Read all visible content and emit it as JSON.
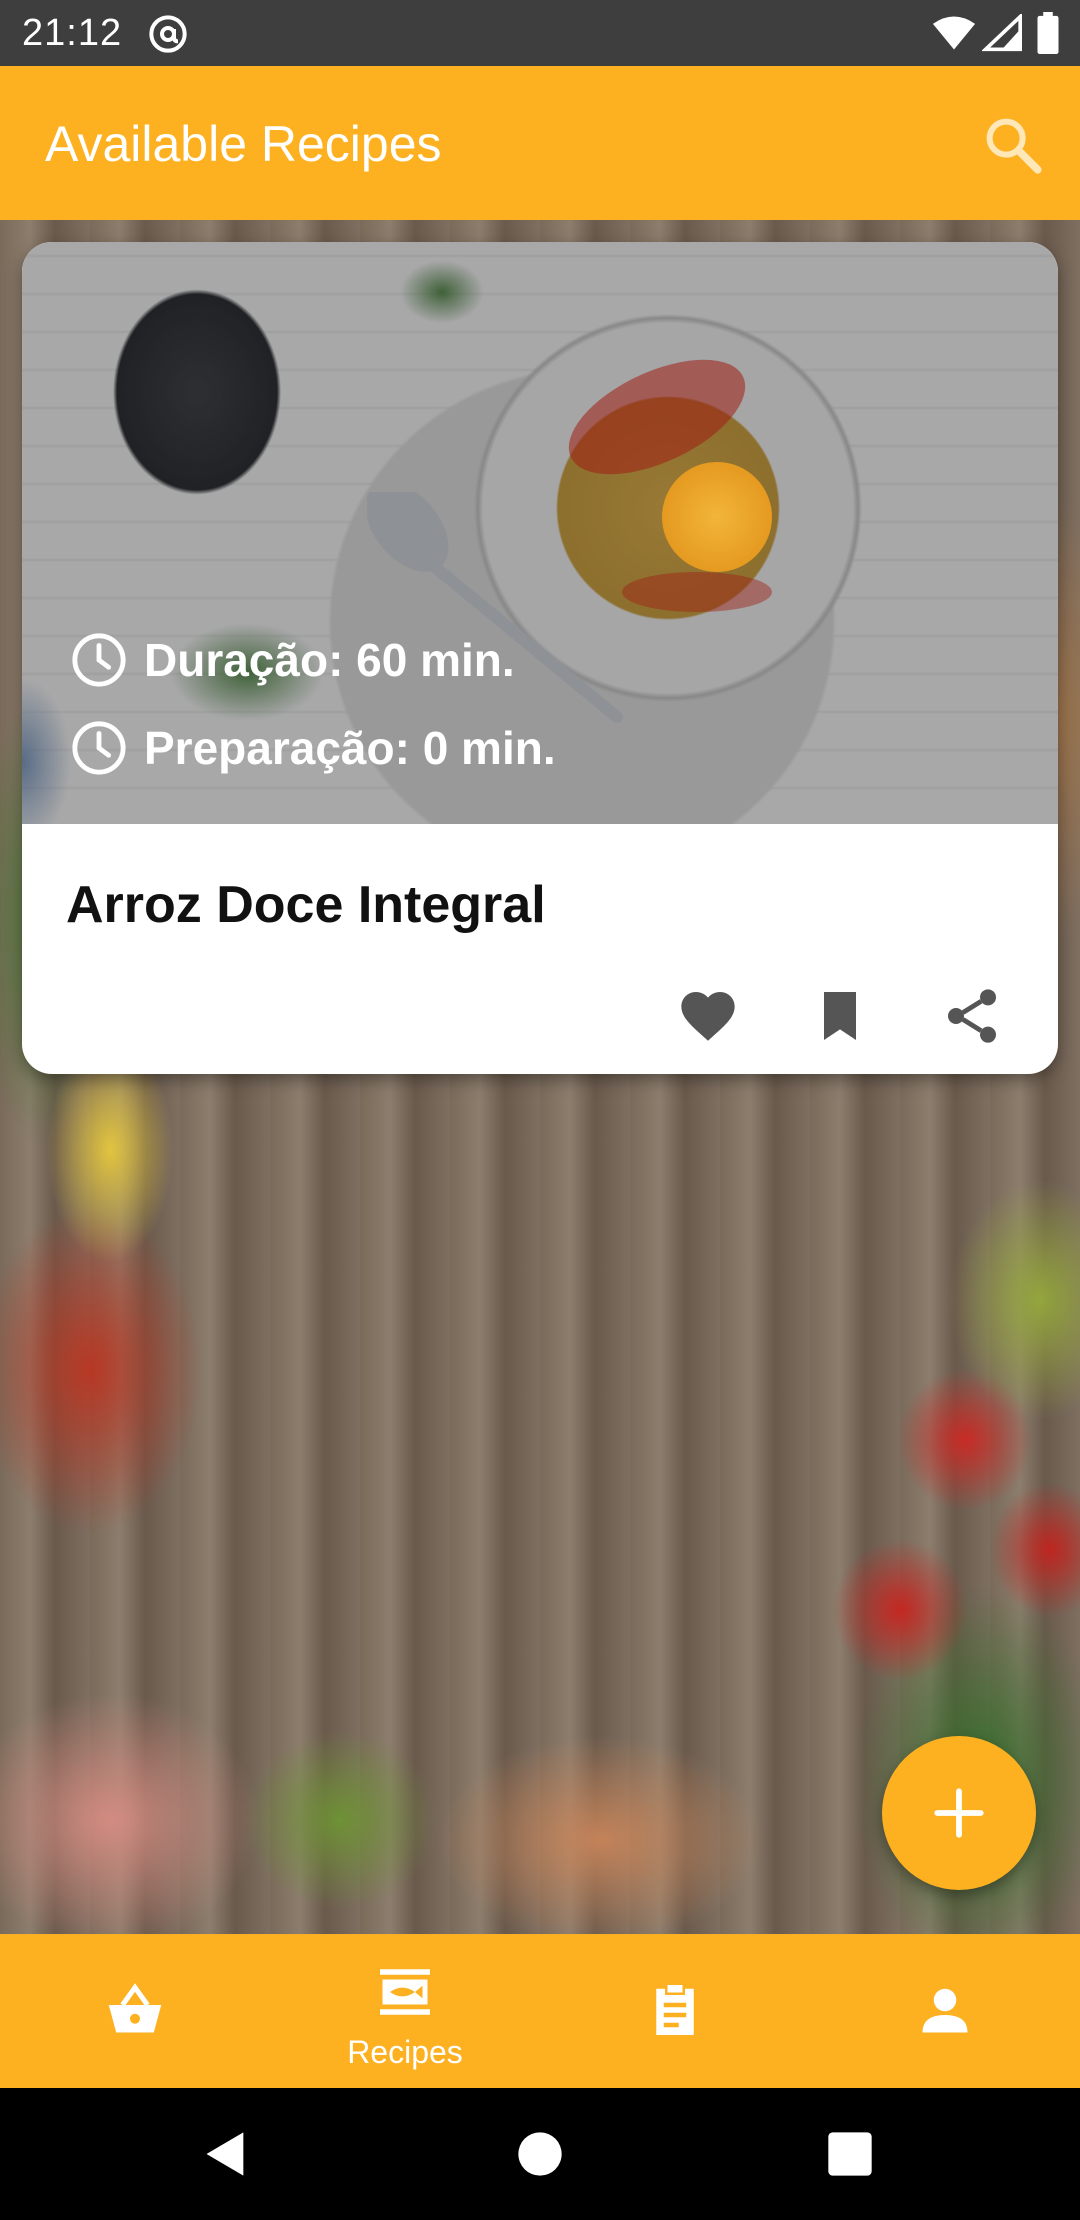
{
  "status_bar": {
    "time": "21:12",
    "icons": [
      "at-sign-icon",
      "wifi-icon",
      "cell-signal-icon",
      "battery-icon"
    ]
  },
  "app_bar": {
    "title": "Available Recipes",
    "search_icon": "search-icon"
  },
  "recipe_card": {
    "duration": "Duração: 60 min.",
    "preparation": "Preparação: 0 min.",
    "title": "Arroz Doce Integral",
    "actions": [
      "heart-icon",
      "bookmark-icon",
      "share-icon"
    ]
  },
  "fab": {
    "icon": "plus-icon"
  },
  "bottom_nav": {
    "items": [
      {
        "icon": "shopping-basket-icon",
        "label": ""
      },
      {
        "icon": "recipes-icon",
        "label": "Recipes"
      },
      {
        "icon": "clipboard-icon",
        "label": ""
      },
      {
        "icon": "person-icon",
        "label": ""
      }
    ],
    "active_index": 1
  },
  "system_nav": {
    "icons": [
      "back-icon",
      "home-icon",
      "recents-icon"
    ]
  },
  "colors": {
    "accent": "#fdb020",
    "status_bar": "#3e3e3e",
    "card_background": "#ffffff",
    "action_icon": "#555555",
    "title_text": "#111111"
  }
}
